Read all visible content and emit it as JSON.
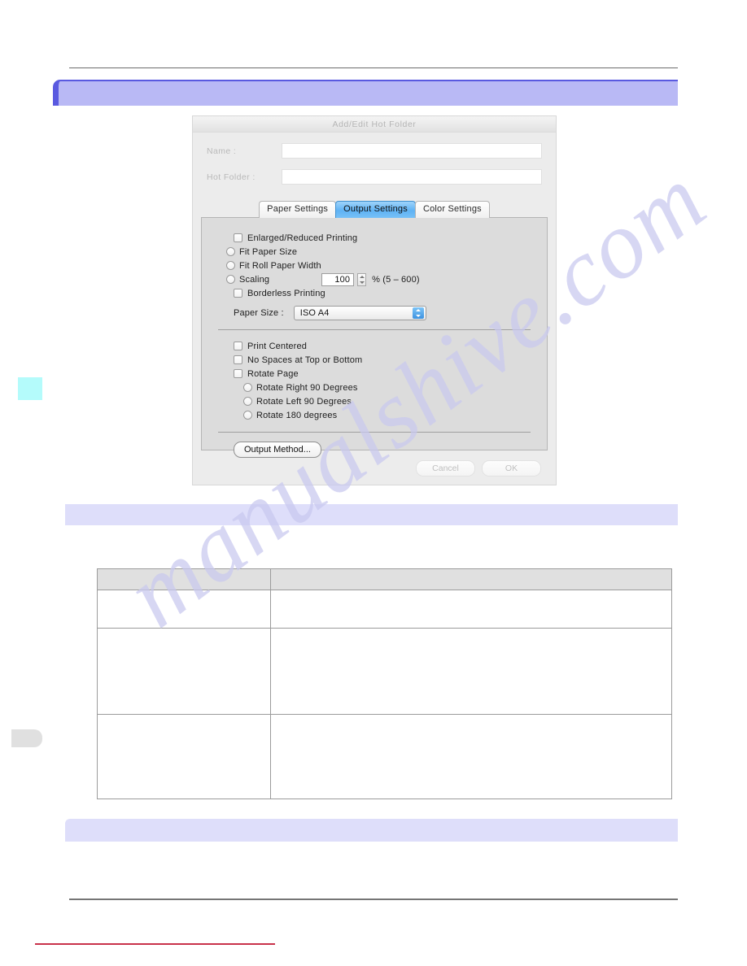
{
  "page": {
    "watermark_text": "manualshive.com"
  },
  "banners": {
    "header": "",
    "middle": "",
    "footer": ""
  },
  "dialog": {
    "title": "Add/Edit Hot Folder",
    "fields": [
      {
        "label": "Name :",
        "value": "",
        "placeholder": ""
      },
      {
        "label": "Hot Folder :",
        "value": "",
        "placeholder": ""
      }
    ],
    "tabs": [
      {
        "label": "Paper Settings",
        "active": false
      },
      {
        "label": "Output Settings",
        "active": true
      },
      {
        "label": "Color Settings",
        "active": false
      }
    ],
    "output_settings": {
      "enlarged_reduced_printing": {
        "label": "Enlarged/Reduced Printing",
        "checked": false
      },
      "scale_options": [
        {
          "label": "Fit Paper Size",
          "selected": false
        },
        {
          "label": "Fit Roll Paper Width",
          "selected": false
        },
        {
          "label": "Scaling",
          "selected": false
        }
      ],
      "scaling_value": "100",
      "scaling_unit_note": "% (5 – 600)",
      "borderless_printing": {
        "label": "Borderless Printing",
        "checked": false
      },
      "paper_size": {
        "label": "Paper Size :",
        "value": "ISO A4"
      },
      "layout_options": [
        {
          "label": "Print Centered",
          "checked": false
        },
        {
          "label": "No Spaces at Top or Bottom",
          "checked": false
        },
        {
          "label": "Rotate Page",
          "checked": false
        }
      ],
      "rotate_options": [
        {
          "label": "Rotate Right 90 Degrees",
          "selected": false
        },
        {
          "label": "Rotate Left 90 Degrees",
          "selected": false
        },
        {
          "label": "Rotate 180 degrees",
          "selected": false
        }
      ],
      "output_method_button": "Output Method..."
    },
    "footer_buttons": {
      "cancel": "Cancel",
      "ok": "OK"
    }
  },
  "content_table": {
    "headers": [
      "",
      ""
    ],
    "rows": [
      [
        "",
        ""
      ],
      [
        "",
        ""
      ],
      [
        "",
        ""
      ]
    ]
  },
  "colors": {
    "banner_light": "#c3c3f6",
    "banner_pale": "#dedefa",
    "banner_edge": "#5a5ae0",
    "tab_active": "#5fb2f4",
    "edge_tab_cyan": "#b4fbfb",
    "edge_tab_gray": "#e0e0e0",
    "red_rule": "#c8324a"
  }
}
